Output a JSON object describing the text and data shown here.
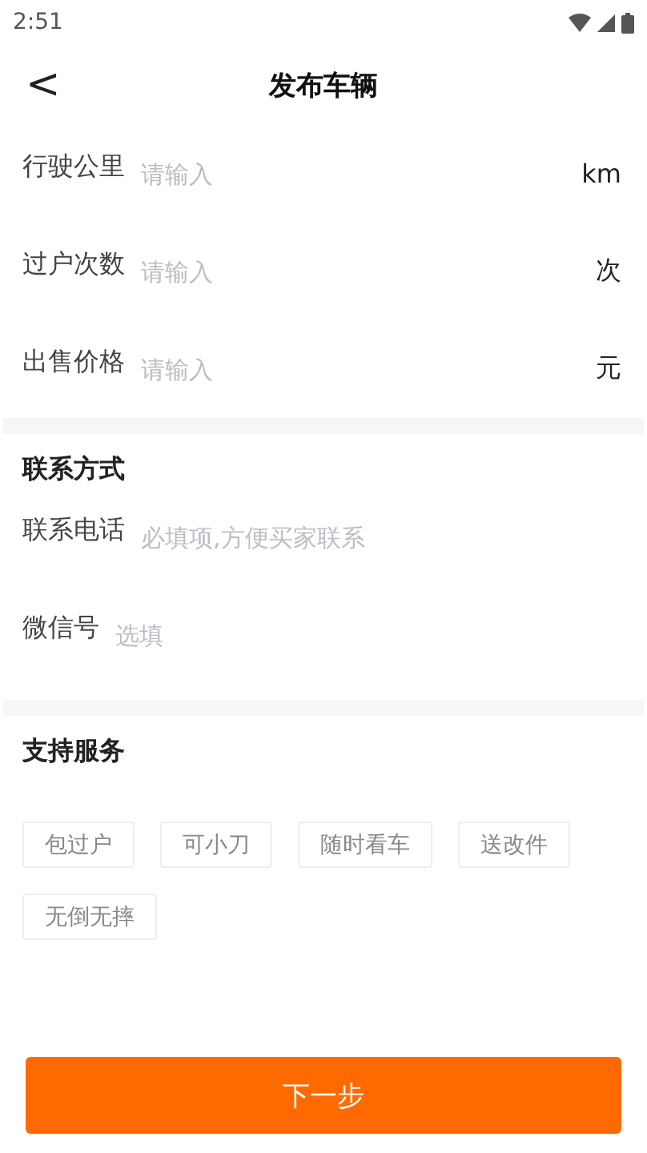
{
  "status_bar": {
    "time": "2:51"
  },
  "header": {
    "back": "<",
    "title": "发布车辆"
  },
  "vehicle_fields": [
    {
      "label": "行驶公里",
      "placeholder": "请输入",
      "unit": "km"
    },
    {
      "label": "过户次数",
      "placeholder": "请输入",
      "unit": "次"
    },
    {
      "label": "出售价格",
      "placeholder": "请输入",
      "unit": "元"
    }
  ],
  "contact": {
    "title": "联系方式",
    "fields": [
      {
        "label": "联系电话",
        "placeholder": "必填项,方便买家联系"
      },
      {
        "label": "微信号",
        "placeholder": "选填"
      }
    ]
  },
  "services": {
    "title": "支持服务",
    "tags": [
      "包过户",
      "可小刀",
      "随时看车",
      "送改件",
      "无倒无摔"
    ]
  },
  "next_button": "下一步"
}
